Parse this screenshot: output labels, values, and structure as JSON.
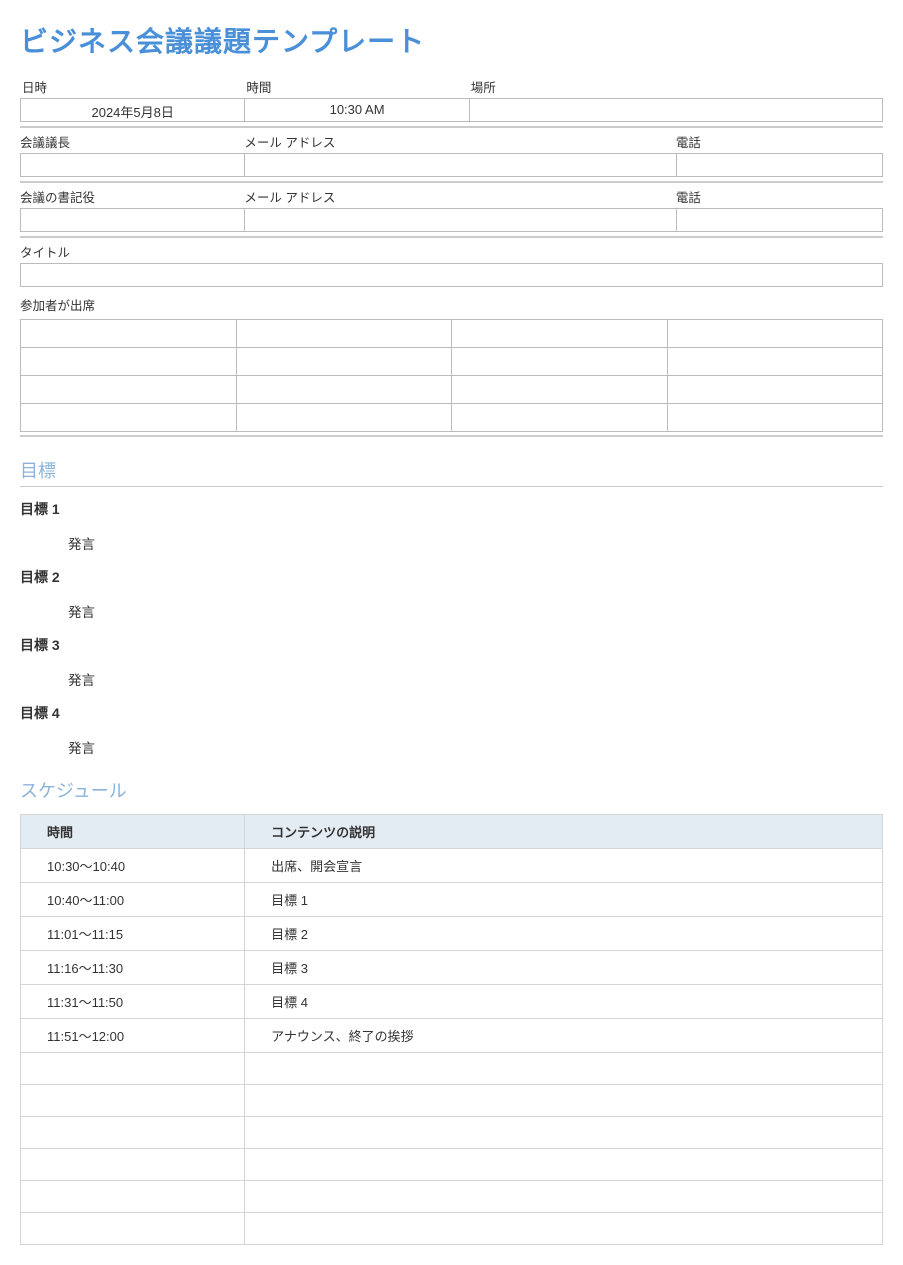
{
  "title": "ビジネス会議議題テンプレート",
  "header": {
    "row1": {
      "date_label": "日時",
      "date_value": "2024年5月8日",
      "time_label": "時間",
      "time_value": "10:30 AM",
      "place_label": "場所",
      "place_value": ""
    },
    "chair": {
      "name_label": "会議議長",
      "name_value": "",
      "email_label": "メール アドレス",
      "email_value": "",
      "phone_label": "電話",
      "phone_value": ""
    },
    "secretary": {
      "name_label": "会議の書記役",
      "name_value": "",
      "email_label": "メール アドレス",
      "email_value": "",
      "phone_label": "電話",
      "phone_value": ""
    },
    "title_row": {
      "label": "タイトル",
      "value": ""
    },
    "attendees_label": "参加者が出席"
  },
  "goals_heading": "目標",
  "goals": {
    "g1": {
      "title": "目標 1",
      "sub": "発言"
    },
    "g2": {
      "title": "目標 2",
      "sub": "発言"
    },
    "g3": {
      "title": "目標 3",
      "sub": "発言"
    },
    "g4": {
      "title": "目標 4",
      "sub": "発言"
    }
  },
  "schedule_heading": "スケジュール",
  "schedule": {
    "col_time": "時間",
    "col_desc": "コンテンツの説明",
    "rows": {
      "r1": {
        "time": "10:30～10:40",
        "desc": "出席、開会宣言"
      },
      "r2": {
        "time": "10:40～11:00",
        "desc": "目標 1"
      },
      "r3": {
        "time": "11:01～11:15",
        "desc": "目標 2"
      },
      "r4": {
        "time": "11:16～11:30",
        "desc": "目標 3"
      },
      "r5": {
        "time": "11:31～11:50",
        "desc": "目標 4"
      },
      "r6": {
        "time": "11:51～12:00",
        "desc": "アナウンス、終了の挨拶"
      }
    }
  }
}
